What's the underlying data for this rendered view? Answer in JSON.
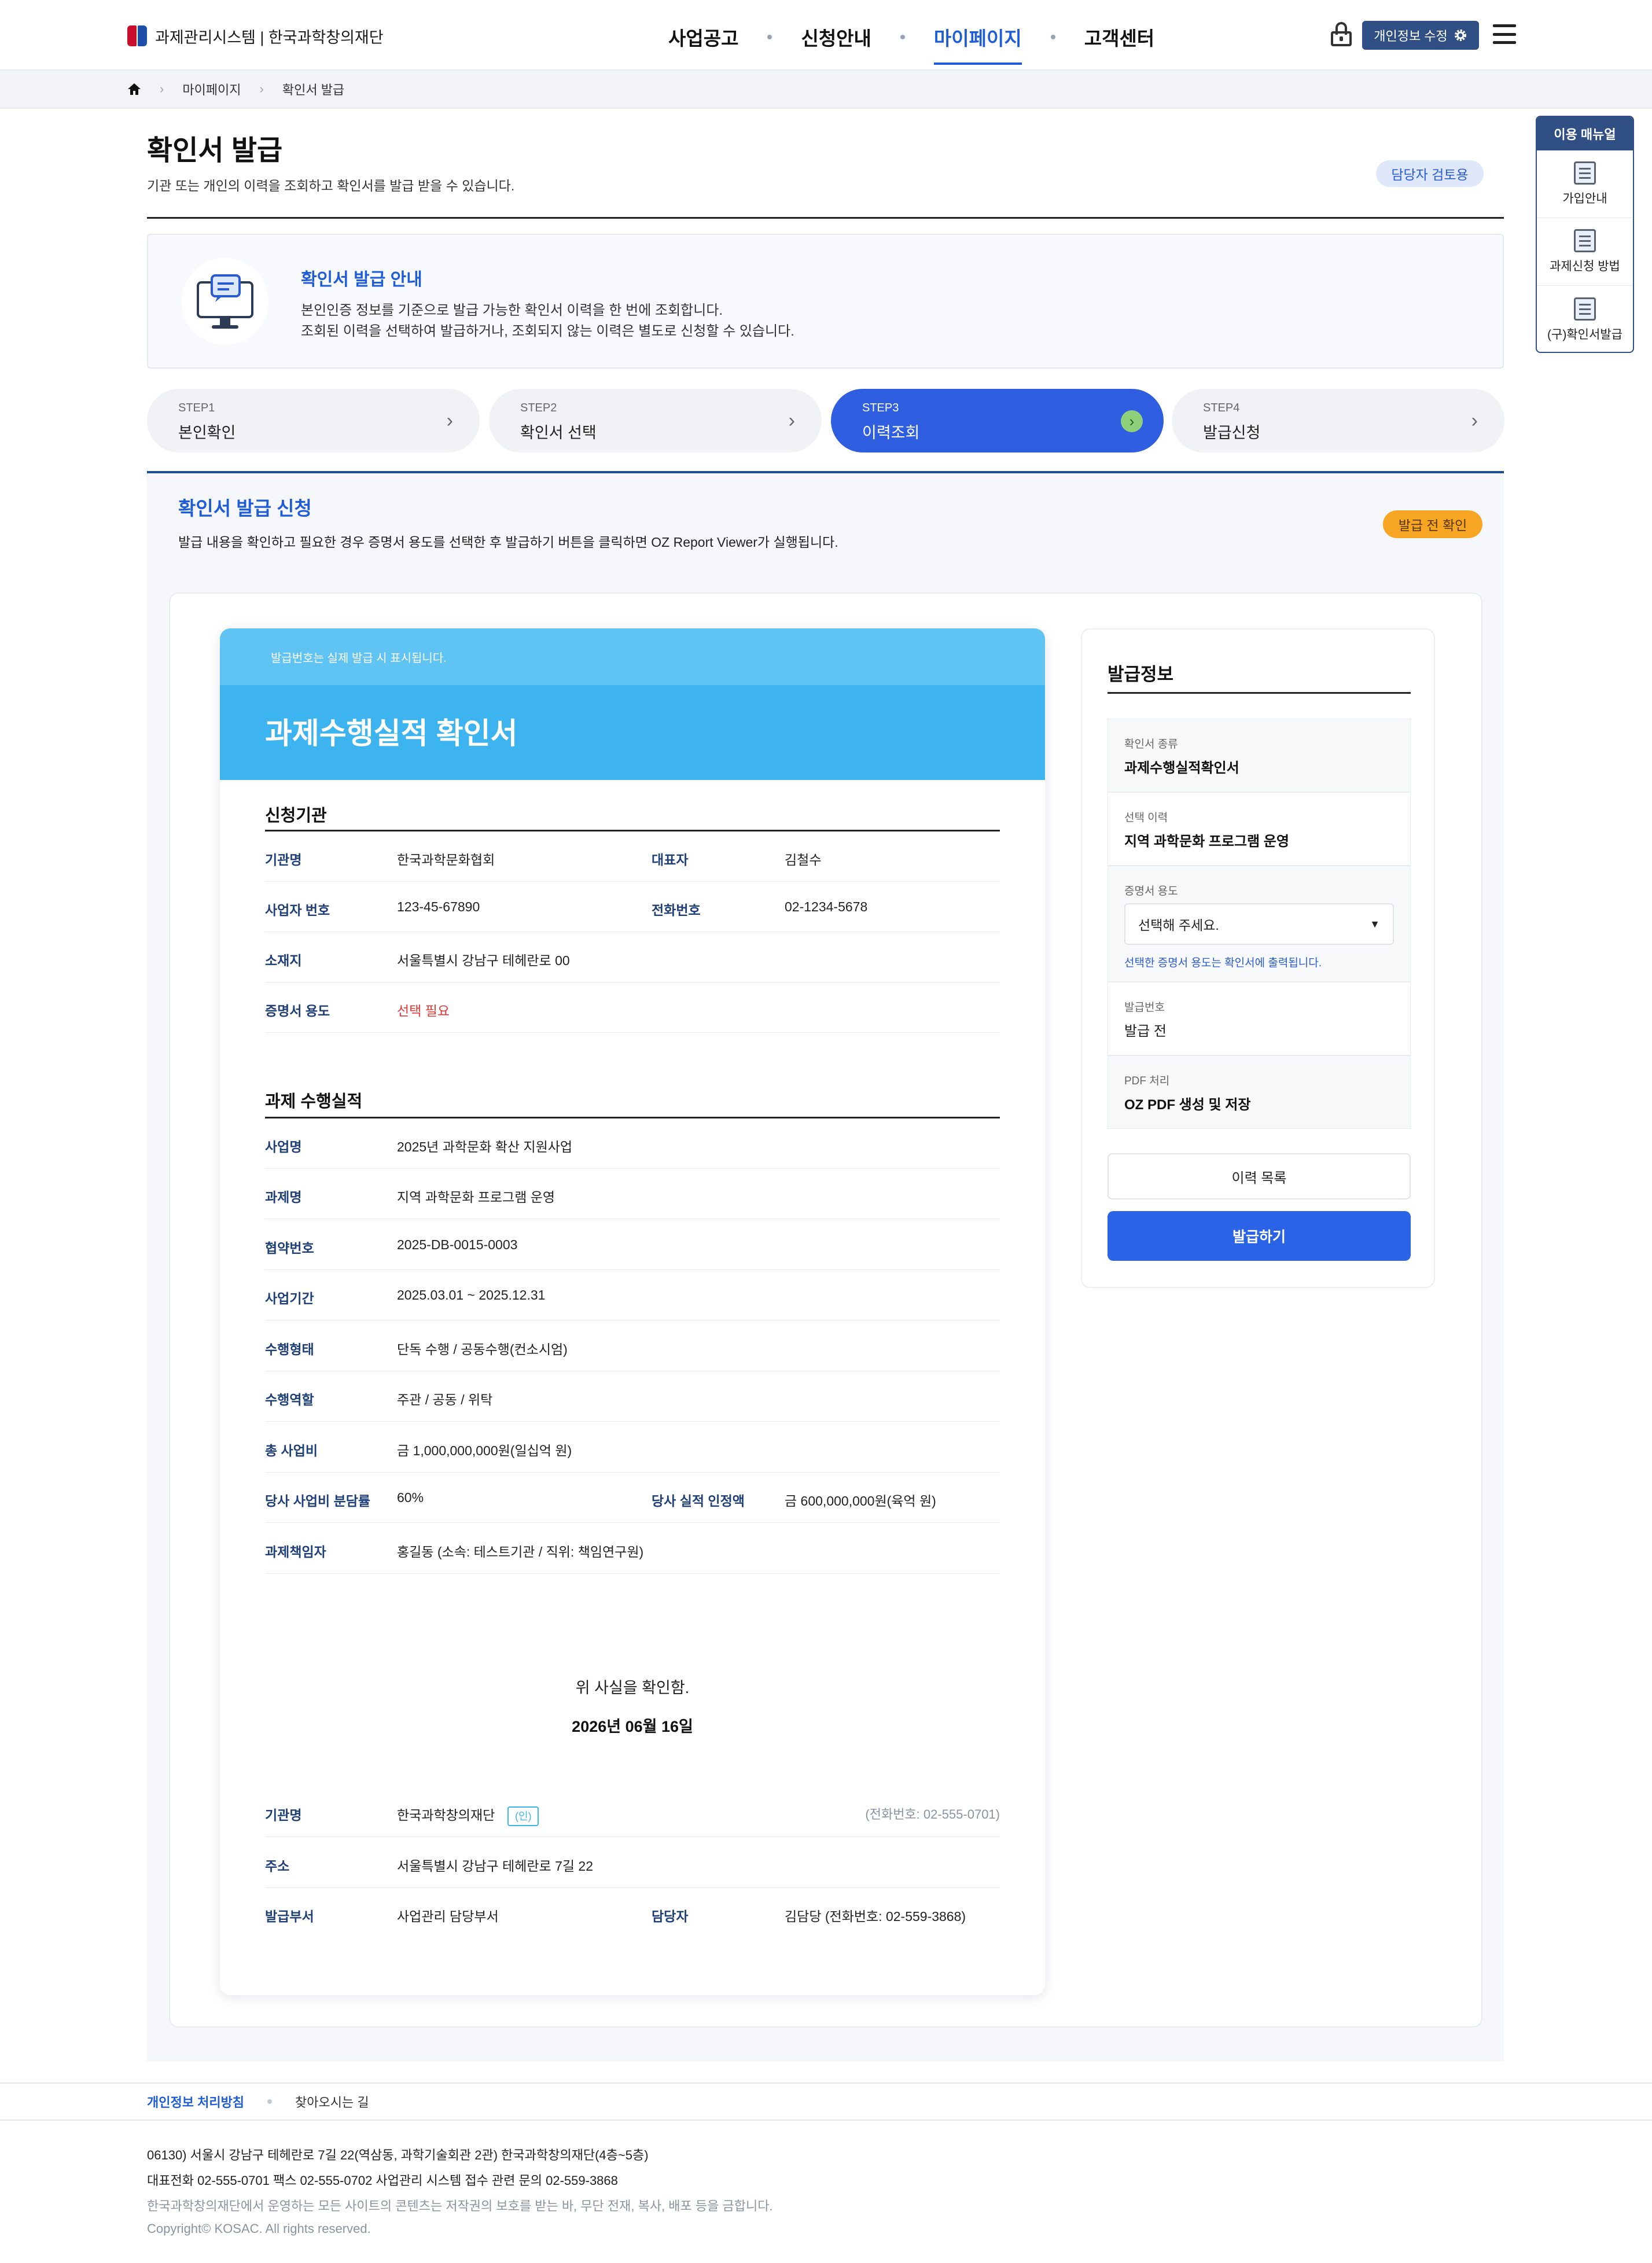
{
  "header": {
    "logo_text": "과제관리시스템 | 한국과학창의재단",
    "nav": [
      "사업공고",
      "신청안내",
      "마이페이지",
      "고객센터"
    ],
    "active_nav": "마이페이지",
    "profile_button": "개인정보 수정"
  },
  "breadcrumb": [
    "마이페이지",
    "확인서 발급"
  ],
  "page": {
    "title": "확인서 발급",
    "description": "기관 또는 개인의 이력을 조회하고 확인서를 발급 받을 수 있습니다.",
    "reviewer_badge": "담당자 검토용"
  },
  "info": {
    "title": "확인서 발급 안내",
    "line1": "본인인증 정보를 기준으로 발급 가능한 확인서 이력을 한 번에 조회합니다.",
    "line2": "조회된 이력을 선택하여 발급하거나, 조회되지 않는 이력은 별도로 신청할 수 있습니다."
  },
  "steps": [
    {
      "label": "STEP1",
      "name": "본인확인"
    },
    {
      "label": "STEP2",
      "name": "확인서 선택"
    },
    {
      "label": "STEP3",
      "name": "이력조회"
    },
    {
      "label": "STEP4",
      "name": "발급신청"
    }
  ],
  "active_step": 3,
  "request": {
    "title": "확인서 발급 신청",
    "description": "발급 내용을 확인하고 필요한 경우 증명서 용도를 선택한 후 발급하기 버튼을 클릭하면 OZ Report Viewer가 실행됩니다.",
    "badge": "발급 전 확인"
  },
  "document": {
    "notice": "발급번호는 실제 발급 시 표시됩니다.",
    "title": "과제수행실적 확인서",
    "applicant_heading": "신청기관",
    "applicant": {
      "org_label": "기관명",
      "org": "한국과학문화협회",
      "ceo_label": "대표자",
      "ceo": "김철수",
      "bizno_label": "사업자 번호",
      "bizno": "123-45-67890",
      "tel_label": "전화번호",
      "tel": "02-1234-5678",
      "addr_label": "소재지",
      "addr": "서울특별시 강남구 테헤란로 00",
      "purpose_label": "증명서 용도",
      "purpose": "선택 필요"
    },
    "performance_heading": "과제 수행실적",
    "performance": [
      {
        "k": "사업명",
        "v": "2025년 과학문화 확산 지원사업"
      },
      {
        "k": "과제명",
        "v": "지역 과학문화 프로그램 운영"
      },
      {
        "k": "협약번호",
        "v": "2025-DB-0015-0003"
      },
      {
        "k": "사업기간",
        "v": "2025.03.01 ~ 2025.12.31"
      },
      {
        "k": "수행형태",
        "v": "단독 수행 / 공동수행(컨소시엄)"
      },
      {
        "k": "수행역할",
        "v": "주관 / 공동 / 위탁"
      },
      {
        "k": "총 사업비",
        "v": "금 1,000,000,000원(일십억 원)"
      }
    ],
    "share": {
      "k": "당사 사업비 분담률",
      "v": "60%",
      "k2": "당사 실적 인정액",
      "v2": "금 600,000,000원(육억 원)"
    },
    "manager": {
      "k": "과제책임자",
      "v": "홍길동 (소속: 테스트기관 / 직위: 책임연구원)"
    },
    "confirm_text": "위 사실을 확인함.",
    "date": "2026년 06월 16일",
    "issuer": {
      "org_label": "기관명",
      "org": "한국과학창의재단",
      "seal": "(인)",
      "tel": "(전화번호: 02-555-0701)",
      "addr_label": "주소",
      "addr": "서울특별시 강남구 테헤란로 7길 22",
      "dept_label": "발급부서",
      "dept": "사업관리 담당부서",
      "staff_label": "담당자",
      "staff": "김담당 (전화번호: 02-559-3868)"
    }
  },
  "side": {
    "title": "발급정보",
    "type_label": "확인서 종류",
    "type": "과제수행실적확인서",
    "history_label": "선택 이력",
    "history": "지역 과학문화 프로그램 운영",
    "purpose_label": "증명서 용도",
    "purpose_select": "선택해 주세요.",
    "purpose_hint": "선택한 증명서 용도는 확인서에 출력됩니다.",
    "issue_no_label": "발급번호",
    "issue_no": "발급 전",
    "pdf_label": "PDF 처리",
    "pdf": "OZ PDF 생성 및 저장",
    "list_button": "이력 목록",
    "issue_button": "발급하기"
  },
  "manual": {
    "title": "이용 매뉴얼",
    "items": [
      "가입안내",
      "과제신청 방법",
      "(구)확인서발급"
    ]
  },
  "footer": {
    "privacy": "개인정보 처리방침",
    "directions": "찾아오시는 길",
    "address": "06130) 서울시 강남구 테헤란로 7길 22(역삼동, 과학기술회관 2관) 한국과학창의재단(4층~5층)",
    "contacts": "대표전화 02-555-0701 팩스 02-555-0702 사업관리 시스템 접수 관련 문의 02-559-3868",
    "copyright_notice": "한국과학창의재단에서 운영하는 모든 사이트의 콘텐츠는 저작권의 보호를 받는 바, 무단 전재, 복사, 배포 등을 금합니다.",
    "copyright": "Copyright© KOSAC. All rights reserved."
  },
  "colors": {
    "primary": "#1e5cd8",
    "navy": "#2f4f85",
    "doc_band": "#3db4f0",
    "badge_orange": "#f6a623"
  }
}
